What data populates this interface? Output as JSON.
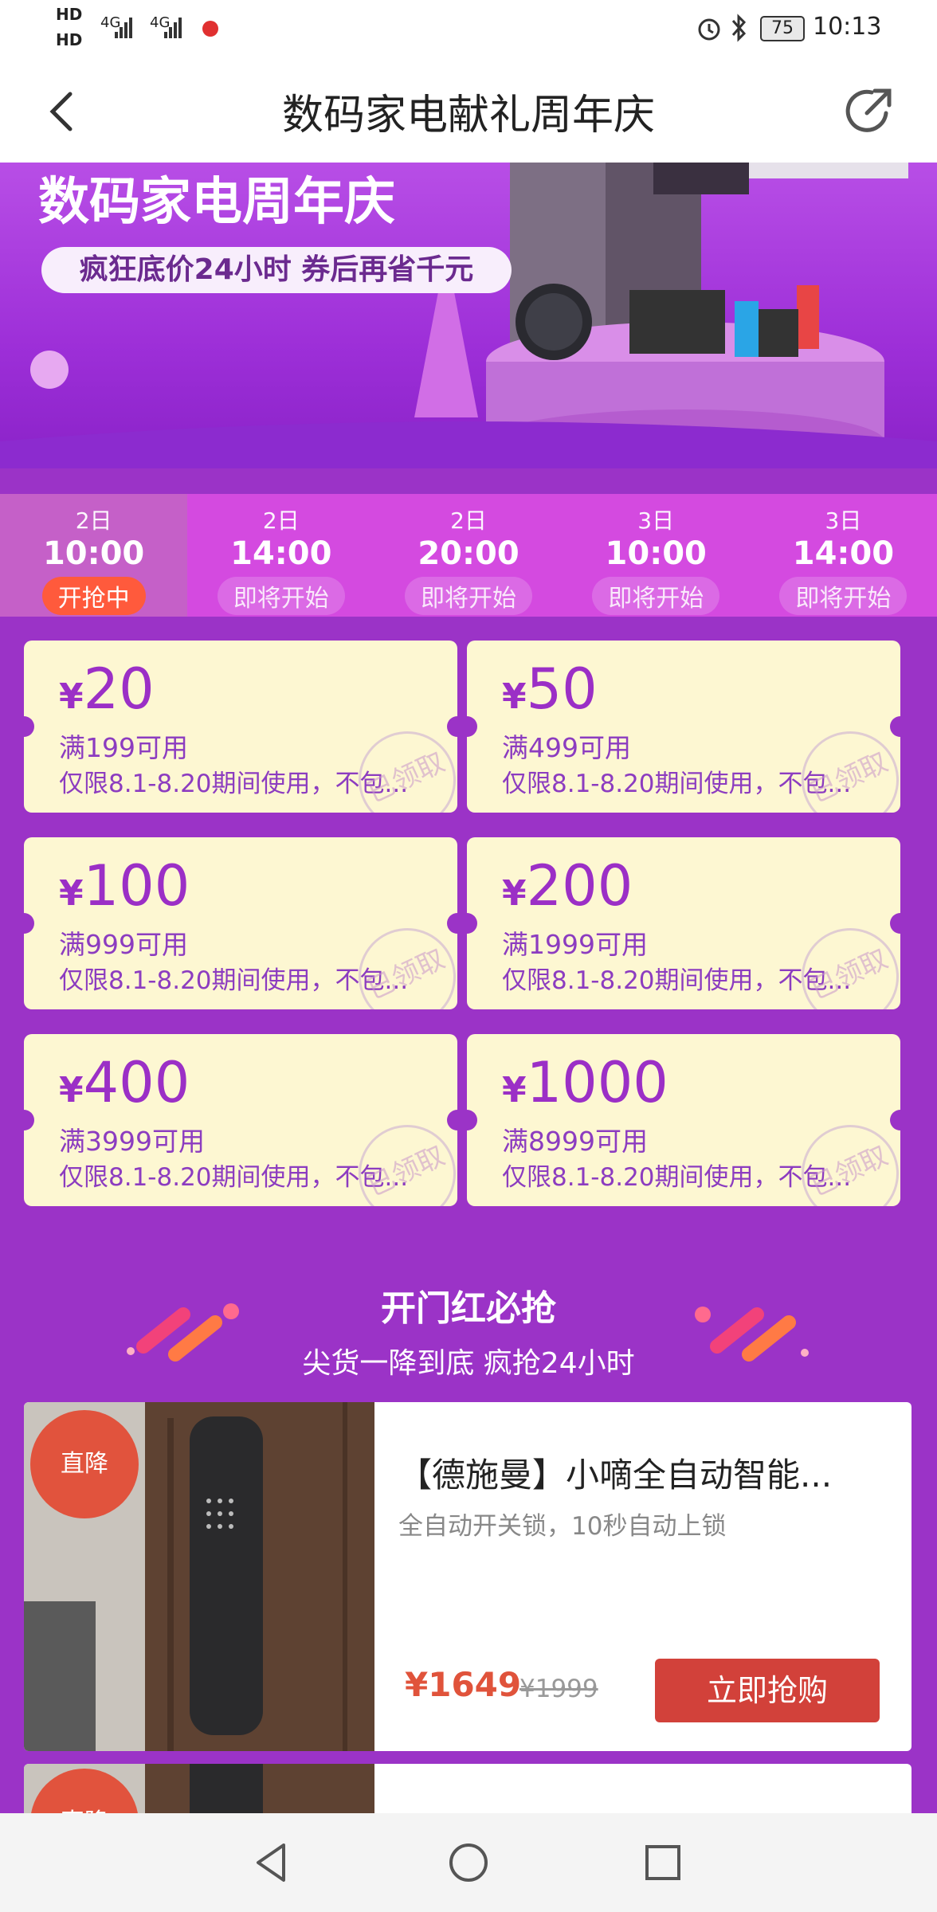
{
  "status": {
    "time": "10:13",
    "battery": "75",
    "signal1": "4G",
    "signal2": "4G",
    "hd1": "HD",
    "hd2": "HD"
  },
  "nav": {
    "title": "数码家电献礼周年庆"
  },
  "banner": {
    "title": "数码家电周年庆",
    "subtitle": "疯狂底价24小时 券后再省千元"
  },
  "tabs": [
    {
      "date": "2日",
      "time": "10:00",
      "status": "开抢中"
    },
    {
      "date": "2日",
      "time": "14:00",
      "status": "即将开始"
    },
    {
      "date": "2日",
      "time": "20:00",
      "status": "即将开始"
    },
    {
      "date": "3日",
      "time": "10:00",
      "status": "即将开始"
    },
    {
      "date": "3日",
      "time": "14:00",
      "status": "即将开始"
    }
  ],
  "coupons": [
    {
      "symbol": "¥",
      "amount": "20",
      "condition": "满199可用",
      "note": "仅限8.1-8.20期间使用，不包...",
      "stamp": "已领取"
    },
    {
      "symbol": "¥",
      "amount": "50",
      "condition": "满499可用",
      "note": "仅限8.1-8.20期间使用，不包...",
      "stamp": "已领取"
    },
    {
      "symbol": "¥",
      "amount": "100",
      "condition": "满999可用",
      "note": "仅限8.1-8.20期间使用，不包...",
      "stamp": "已领取"
    },
    {
      "symbol": "¥",
      "amount": "200",
      "condition": "满1999可用",
      "note": "仅限8.1-8.20期间使用，不包...",
      "stamp": "已领取"
    },
    {
      "symbol": "¥",
      "amount": "400",
      "condition": "满3999可用",
      "note": "仅限8.1-8.20期间使用，不包...",
      "stamp": "已领取"
    },
    {
      "symbol": "¥",
      "amount": "1000",
      "condition": "满8999可用",
      "note": "仅限8.1-8.20期间使用，不包...",
      "stamp": "已领取"
    }
  ],
  "section": {
    "title": "开门红必抢",
    "subtitle": "尖货一降到底 疯抢24小时"
  },
  "product": {
    "badge": "直降",
    "title": "【德施曼】小嘀全自动智能...",
    "desc": "全自动开关锁，10秒自动上锁",
    "price": "¥1649",
    "old_price": "¥1999",
    "buy": "立即抢购"
  },
  "product2": {
    "badge": "直降"
  },
  "colors": {
    "accent": "#9b2fc6",
    "buy": "#d2413a",
    "badge": "#e1533d",
    "coupon_bg": "#fdf7d2",
    "page_bg": "#9b33c7"
  }
}
